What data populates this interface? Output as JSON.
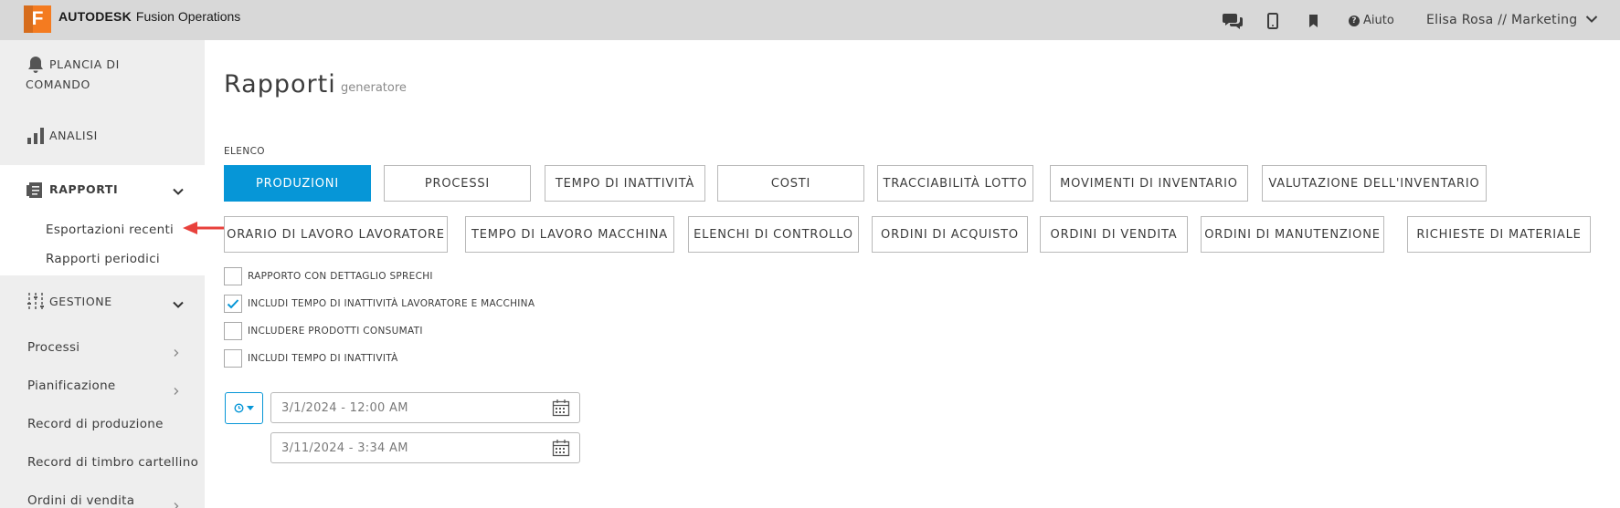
{
  "header": {
    "logo_letter": "F",
    "brand_bold": "AUTODESK",
    "brand_product": "Fusion Operations",
    "help_label": "Aiuto",
    "user_label": "Elisa Rosa // Marketing",
    "icons": [
      "chat-icon",
      "mobile-icon",
      "bookmark-icon",
      "help-icon",
      "chevron-down-icon"
    ]
  },
  "sidebar": {
    "dashboard": "PLANCIA DI COMANDO",
    "analysis": "ANALISI",
    "reports": "RAPPORTI",
    "reports_sub": [
      "Esportazioni recenti",
      "Rapporti periodici"
    ],
    "management": "GESTIONE",
    "management_items": [
      "Processi",
      "Pianificazione",
      "Record di produzione",
      "Record di timbro cartellino",
      "Ordini di vendita"
    ]
  },
  "main": {
    "title": "Rapporti",
    "subtitle": "generatore",
    "list_label": "ELENCO",
    "report_buttons_row1": [
      "PRODUZIONI",
      "PROCESSI",
      "TEMPO DI INATTIVITÀ",
      "COSTI",
      "TRACCIABILITÀ LOTTO",
      "MOVIMENTI DI INVENTARIO",
      "VALUTAZIONE DELL'INVENTARIO"
    ],
    "report_buttons_row2": [
      "ORARIO DI LAVORO LAVORATORE",
      "TEMPO DI LAVORO MACCHINA",
      "ELENCHI DI CONTROLLO",
      "ORDINI DI ACQUISTO",
      "ORDINI DI VENDITA",
      "ORDINI DI MANUTENZIONE",
      "RICHIESTE DI MATERIALE"
    ],
    "active_button": "PRODUZIONI",
    "options": [
      {
        "label": "RAPPORTO CON DETTAGLIO SPRECHI",
        "checked": false
      },
      {
        "label": "INCLUDI TEMPO DI INATTIVITÀ LAVORATORE E MACCHINA",
        "checked": true
      },
      {
        "label": "INCLUDERE PRODOTTI CONSUMATI",
        "checked": false
      },
      {
        "label": "INCLUDI TEMPO DI INATTIVITÀ",
        "checked": false
      }
    ],
    "date_from": "3/1/2024 - 12:00 AM",
    "date_to": "3/11/2024 - 3:34 AM"
  },
  "colors": {
    "accent": "#0696d7",
    "brand_orange": "#f47b20",
    "topbar": "#d8d8d8",
    "sidebar": "#eeeeee",
    "annotation_arrow": "#e8413c"
  }
}
